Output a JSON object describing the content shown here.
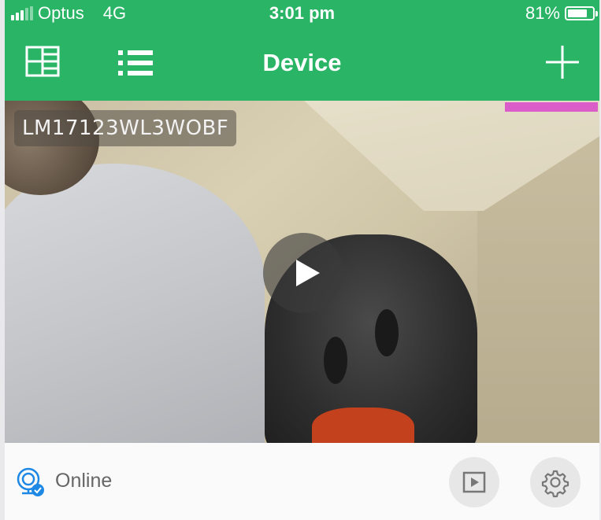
{
  "status_bar": {
    "carrier": "Optus",
    "network": "4G",
    "time": "3:01 pm",
    "battery": "81%",
    "battery_level": 0.81,
    "signal_bars": 3
  },
  "nav": {
    "title": "Device"
  },
  "camera": {
    "device_id": "LM17123WL3WOBF"
  },
  "footer": {
    "status": "Online"
  },
  "colors": {
    "brand": "#2ab466",
    "online_badge": "#1e88e5"
  },
  "icons": [
    "grid-view-icon",
    "list-view-icon",
    "add-icon",
    "play-icon",
    "camera-online-icon",
    "playback-icon",
    "gear-icon",
    "battery-icon",
    "signal-icon"
  ]
}
